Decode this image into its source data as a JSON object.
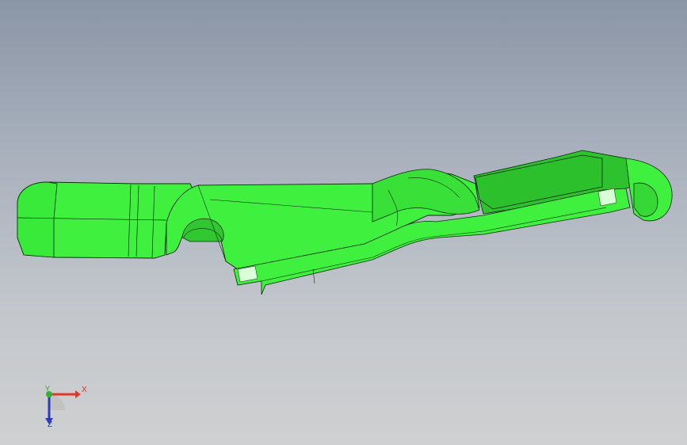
{
  "viewport": {
    "background_top": "#8a95a6",
    "background_bottom": "#cfd0d1"
  },
  "model": {
    "part_color": "#3ff03f",
    "shade_color": "#2fc22f",
    "edge_color": "#0b2a0b"
  },
  "triad": {
    "x_label": "X",
    "y_label": "Y",
    "z_label": "Z",
    "x_color": "#d93b2a",
    "y_color": "#34b234",
    "z_color": "#2b3ab8"
  }
}
